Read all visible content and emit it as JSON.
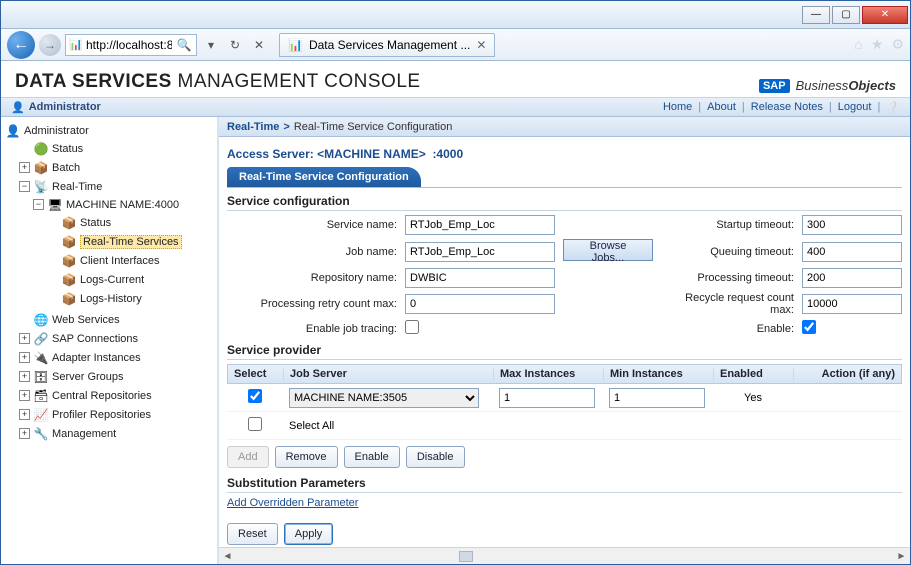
{
  "window": {
    "url": "http://localhost:808",
    "tab_title": "Data Services Management ..."
  },
  "header": {
    "title_bold": "DATA SERVICES",
    "title_rest": " MANAGEMENT CONSOLE",
    "brand_prefix": "Business",
    "brand_suffix": "Objects"
  },
  "topbar": {
    "left_label": "Administrator",
    "links": [
      "Home",
      "About",
      "Release Notes",
      "Logout"
    ]
  },
  "tree": {
    "root": "Administrator",
    "nodes": {
      "status": "Status",
      "batch": "Batch",
      "realtime": "Real-Time",
      "machine": "MACHINE NAME:4000",
      "m_status": "Status",
      "m_rts": "Real-Time Services",
      "m_ci": "Client Interfaces",
      "m_logc": "Logs-Current",
      "m_logh": "Logs-History",
      "webservices": "Web Services",
      "sapconn": "SAP Connections",
      "adapter": "Adapter Instances",
      "sgroups": "Server Groups",
      "crepo": "Central Repositories",
      "prepo": "Profiler Repositories",
      "mgmt": "Management"
    }
  },
  "breadcrumb": {
    "root": "Real-Time",
    "current": "Real-Time Service Configuration"
  },
  "access_server": {
    "label": "Access Server:",
    "name": "<MACHINE NAME>",
    "port": ":4000"
  },
  "subtab": "Real-Time Service Configuration",
  "sections": {
    "config": "Service configuration",
    "provider": "Service provider",
    "subparams": "Substitution Parameters"
  },
  "form": {
    "labels": {
      "service_name": "Service name:",
      "job_name": "Job name:",
      "browse": "Browse Jobs...",
      "repo": "Repository name:",
      "retry": "Processing retry count max:",
      "enable_trace": "Enable job tracing:",
      "startup": "Startup timeout:",
      "queuing": "Queuing timeout:",
      "processing": "Processing timeout:",
      "recycle": "Recycle request count max:",
      "enable": "Enable:"
    },
    "values": {
      "service_name": "RTJob_Emp_Loc",
      "job_name": "RTJob_Emp_Loc",
      "repo": "DWBIC",
      "retry": "0",
      "startup": "300",
      "queuing": "400",
      "processing": "200",
      "recycle": "10000"
    }
  },
  "sp_table": {
    "headers": [
      "Select",
      "Job Server",
      "Max Instances",
      "Min Instances",
      "Enabled",
      "Action (if any)"
    ],
    "rows": [
      {
        "job_server": "MACHINE NAME:3505",
        "max": "1",
        "min": "1",
        "enabled": "Yes"
      }
    ],
    "select_all": "Select All"
  },
  "sp_buttons": {
    "add": "Add",
    "remove": "Remove",
    "enable": "Enable",
    "disable": "Disable"
  },
  "subparams_link": "Add Overridden Parameter",
  "footer_buttons": {
    "reset": "Reset",
    "apply": "Apply"
  }
}
